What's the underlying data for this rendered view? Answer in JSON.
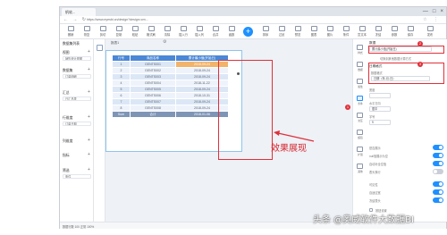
{
  "window": {
    "tab_label": "帆软...",
    "controls": [
      "—",
      "□",
      "×"
    ],
    "url": "https://www.eyesbi.cn/design?design=cm...",
    "url_nav": "← → ↻",
    "url_right": "☆ ⋮"
  },
  "toolbar": {
    "items": [
      "撤销",
      "恢复",
      "剪切",
      "复制",
      "粘贴",
      "格式刷",
      "清除",
      "插入行",
      "插入列",
      "合并",
      "函数",
      "排序",
      "过滤",
      "预览",
      "图表",
      "图片",
      "条件",
      "富文本",
      "冻结",
      "参数",
      "保存",
      "发布"
    ]
  },
  "left_panel": {
    "title": "数据集列表",
    "sections": [
      {
        "label": "视图",
        "item": "销售统计视图"
      },
      {
        "label": "数据集",
        "item": "订单明细"
      },
      {
        "label": "汇总",
        "item": "日汇总表"
      },
      {
        "label": "行维度",
        "item": "订单日期"
      },
      {
        "label": "列维度",
        "item": "字段"
      },
      {
        "label": "指标",
        "item": "金额"
      },
      {
        "label": "筛选",
        "item": "条件"
      }
    ]
  },
  "canvas": {
    "sheet_tab": "报表1",
    "gear_icon": "⚙",
    "headers": [
      "行号",
      "商品名称",
      "累计最小值(开始日)"
    ],
    "rows": [
      {
        "no": "1",
        "name": "GENTS001",
        "date": "2018-09-24"
      },
      {
        "no": "2",
        "name": "GENTS002",
        "date": "2018-09-24"
      },
      {
        "no": "3",
        "name": "GENTS003",
        "date": "2018-09-24"
      },
      {
        "no": "4",
        "name": "GENTS004",
        "date": "2018-11-22"
      },
      {
        "no": "5",
        "name": "GENTS005",
        "date": "2018-09-24"
      },
      {
        "no": "6",
        "name": "GENTS006",
        "date": "2018-10-31"
      },
      {
        "no": "7",
        "name": "GENTS007",
        "date": "2018-09-24"
      },
      {
        "no": "8",
        "name": "GENTS008",
        "date": "2018-09-24"
      }
    ],
    "total": {
      "no": "Sum",
      "name": "合计",
      "date": "2018-01-06"
    },
    "annotation": "效果展现"
  },
  "strip": {
    "items": [
      "样式",
      "数据",
      "属性",
      "条件",
      "交互",
      "超链",
      "扩展",
      "其他"
    ]
  },
  "props": {
    "section_title": "数据",
    "field_value": "累计最小值(开始日)",
    "link": "切换到其他数据计算方式",
    "format_title": "日期格式",
    "format_label": "数据格式",
    "format_value": "日期（年-月-日）",
    "width_label": "宽度",
    "align_label": "水平方向",
    "align_value": "居中",
    "font_label": "字号",
    "size_value": "9",
    "toggles": [
      {
        "label": "是否展示",
        "on": true
      },
      {
        "label": "null值展示为空",
        "on": true
      },
      {
        "label": "自动补全空值",
        "on": true
      },
      {
        "label": "表头换行",
        "on": false
      },
      {
        "label": "可见性",
        "on": true
      },
      {
        "label": "自适应宽",
        "on": true
      },
      {
        "label": "冻结表头",
        "on": true
      }
    ],
    "checkbox_label": "按钮设置",
    "badges": [
      "2",
      "3",
      "1"
    ]
  },
  "status": {
    "text": "数据行数 100  正常  100%"
  },
  "watermark": "头条 @奥威软件大数据BI",
  "colors": {
    "accent": "#1e90ff",
    "header_blue": "#4a87d6",
    "highlight_orange": "#f2b36b",
    "annotation_red": "#e0303a"
  }
}
